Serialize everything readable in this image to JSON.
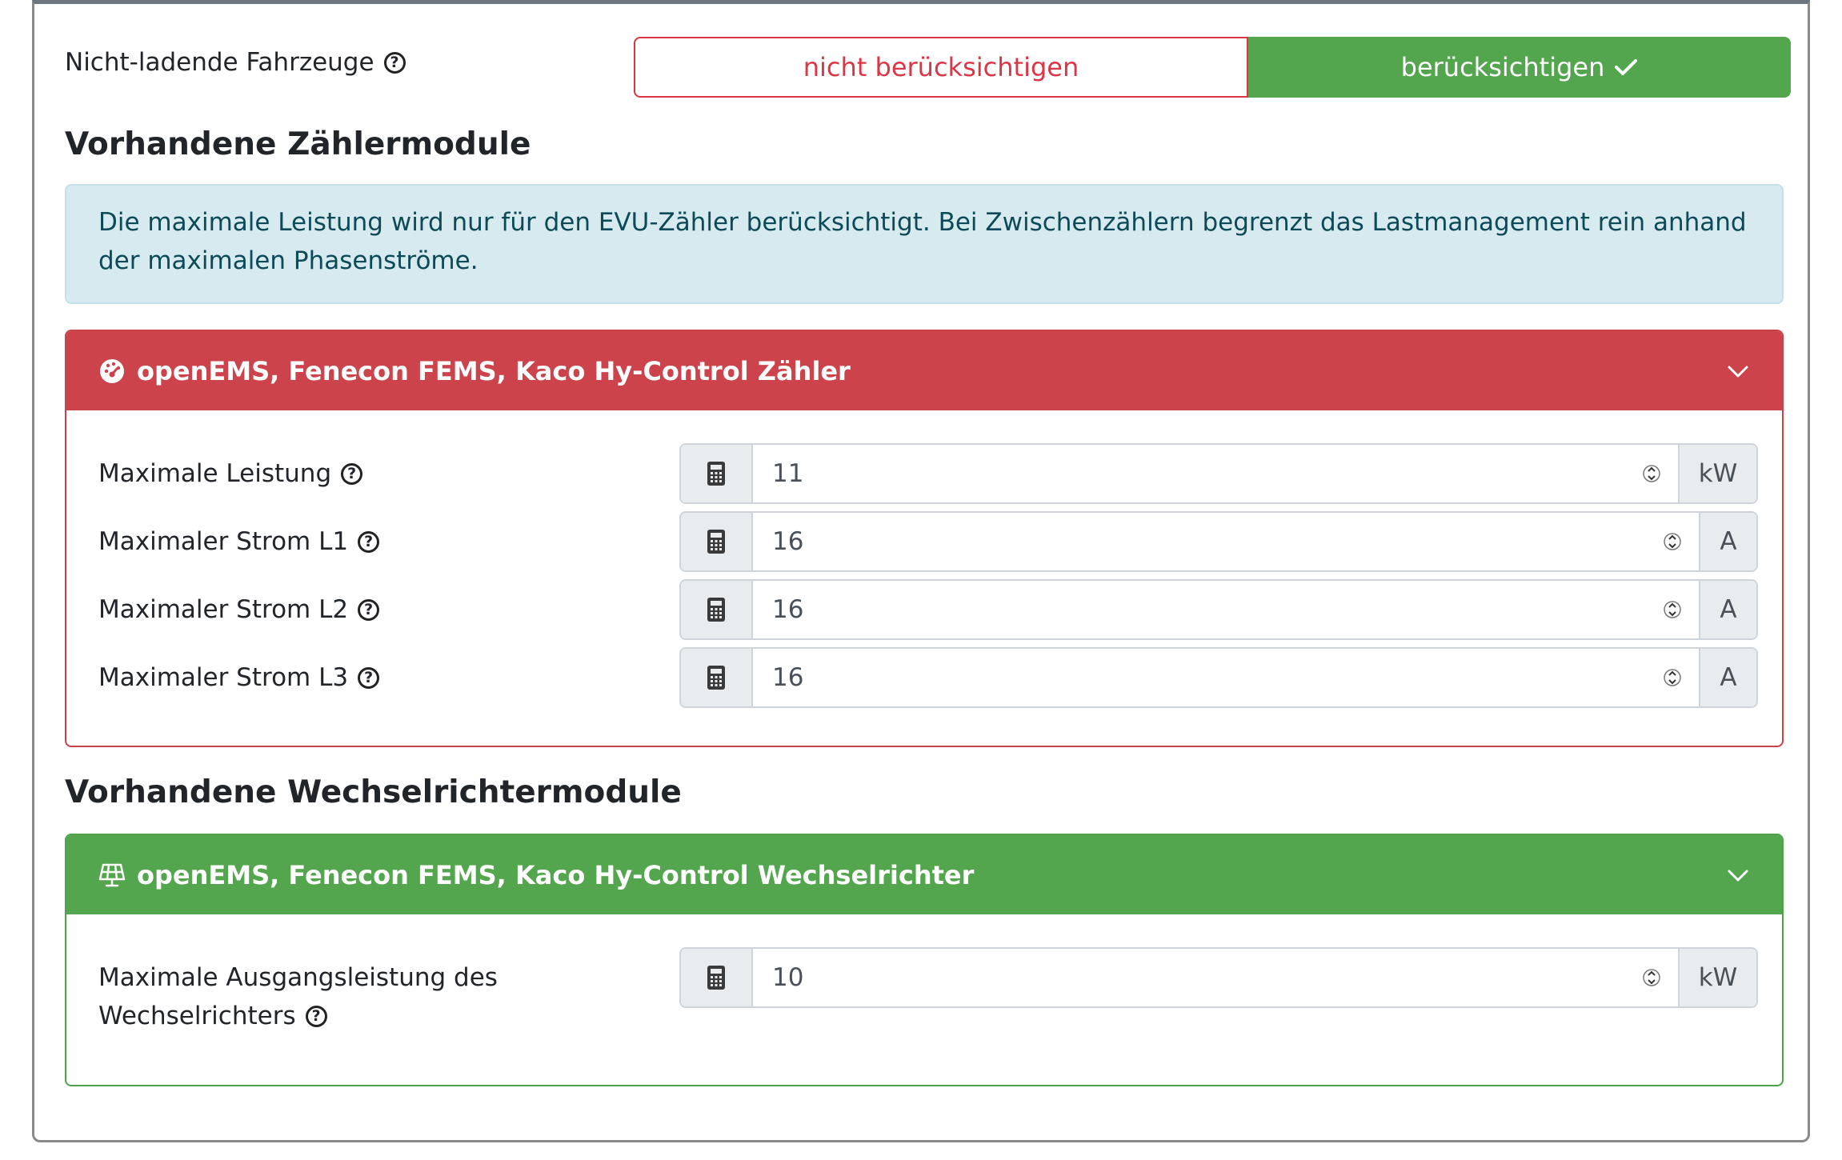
{
  "vehicles": {
    "label": "Nicht-ladende Fahrzeuge",
    "option_off": "nicht berücksichtigen",
    "option_on": "berücksichtigen",
    "selected": "berücksichtigen"
  },
  "meters": {
    "heading": "Vorhandene Zählermodule",
    "info": "Die maximale Leistung wird nur für den EVU-Zähler berücksichtigt. Bei Zwischenzählern begrenzt das Lastmanagement rein anhand der maximalen Phasenströme.",
    "card": {
      "title": "openEMS, Fenecon FEMS, Kaco Hy-Control Zähler",
      "icon": "gauge-icon",
      "color": "#cc434b",
      "fields": [
        {
          "label": "Maximale Leistung",
          "value": "11",
          "unit": "kW"
        },
        {
          "label": "Maximaler Strom L1",
          "value": "16",
          "unit": "A"
        },
        {
          "label": "Maximaler Strom L2",
          "value": "16",
          "unit": "A"
        },
        {
          "label": "Maximaler Strom L3",
          "value": "16",
          "unit": "A"
        }
      ]
    }
  },
  "inverters": {
    "heading": "Vorhandene Wechselrichtermodule",
    "card": {
      "title": "openEMS, Fenecon FEMS, Kaco Hy-Control Wechselrichter",
      "icon": "solar-panel-icon",
      "color": "#54a64e",
      "field": {
        "label_line1": "Maximale Ausgangsleistung des",
        "label_line2": "Wechselrichters",
        "value": "10",
        "unit": "kW"
      }
    }
  }
}
